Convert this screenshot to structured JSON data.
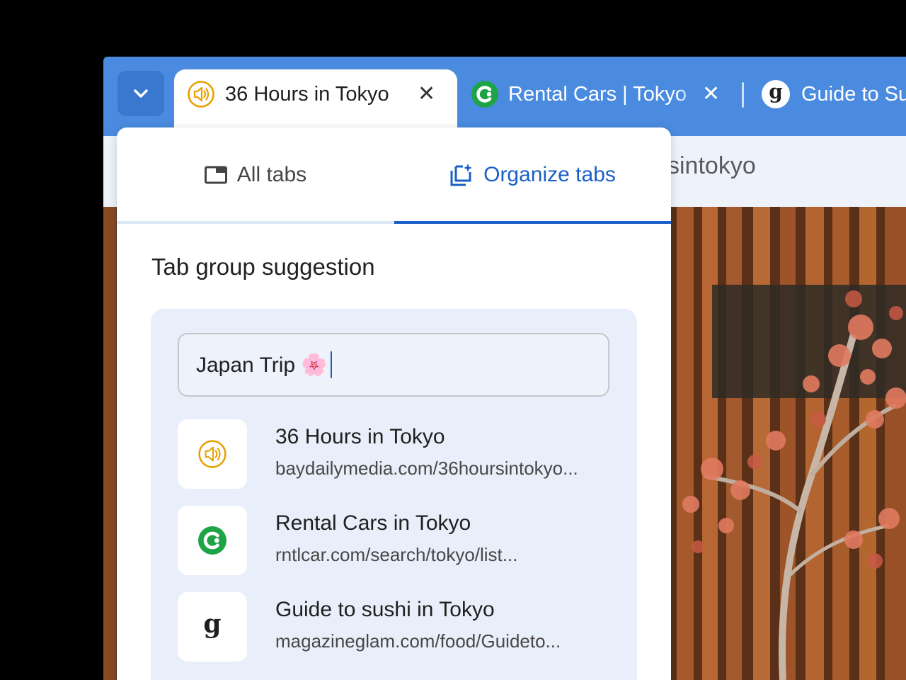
{
  "browser": {
    "tabs": [
      {
        "title": "36 Hours in Tokyo",
        "icon": "audio-icon",
        "active": true,
        "close": "✕"
      },
      {
        "title": "Rental Cars | Tokyo",
        "icon": "rentalcar-logo-icon",
        "active": false,
        "close": "✕"
      },
      {
        "title": "Guide to Su",
        "icon": "g-logo-icon",
        "active": false
      }
    ],
    "omnibox_text": "sintokyo"
  },
  "popup": {
    "tabs": [
      {
        "label": "All tabs",
        "icon": "tab-icon",
        "selected": false
      },
      {
        "label": "Organize tabs",
        "icon": "organize-sparkle-icon",
        "selected": true
      }
    ],
    "section_title": "Tab group suggestion",
    "group_name_value": "Japan Trip 🌸",
    "items": [
      {
        "title": "36 Hours in Tokyo",
        "url": "baydailymedia.com/36hoursintokyo...",
        "icon": "audio-icon"
      },
      {
        "title": "Rental Cars in Tokyo",
        "url": "rntlcar.com/search/tokyo/list...",
        "icon": "rentalcar-logo-icon"
      },
      {
        "title": "Guide to sushi in Tokyo",
        "url": "magazineglam.com/food/Guideto...",
        "icon": "g-logo-icon"
      }
    ]
  },
  "colors": {
    "tabstrip": "#4a8be0",
    "accent": "#1a5fc7",
    "card": "#e9effa",
    "audio_icon": "#e8a000",
    "rentalcar_green": "#1ea446"
  },
  "icons": {
    "g_glyph": "g"
  }
}
